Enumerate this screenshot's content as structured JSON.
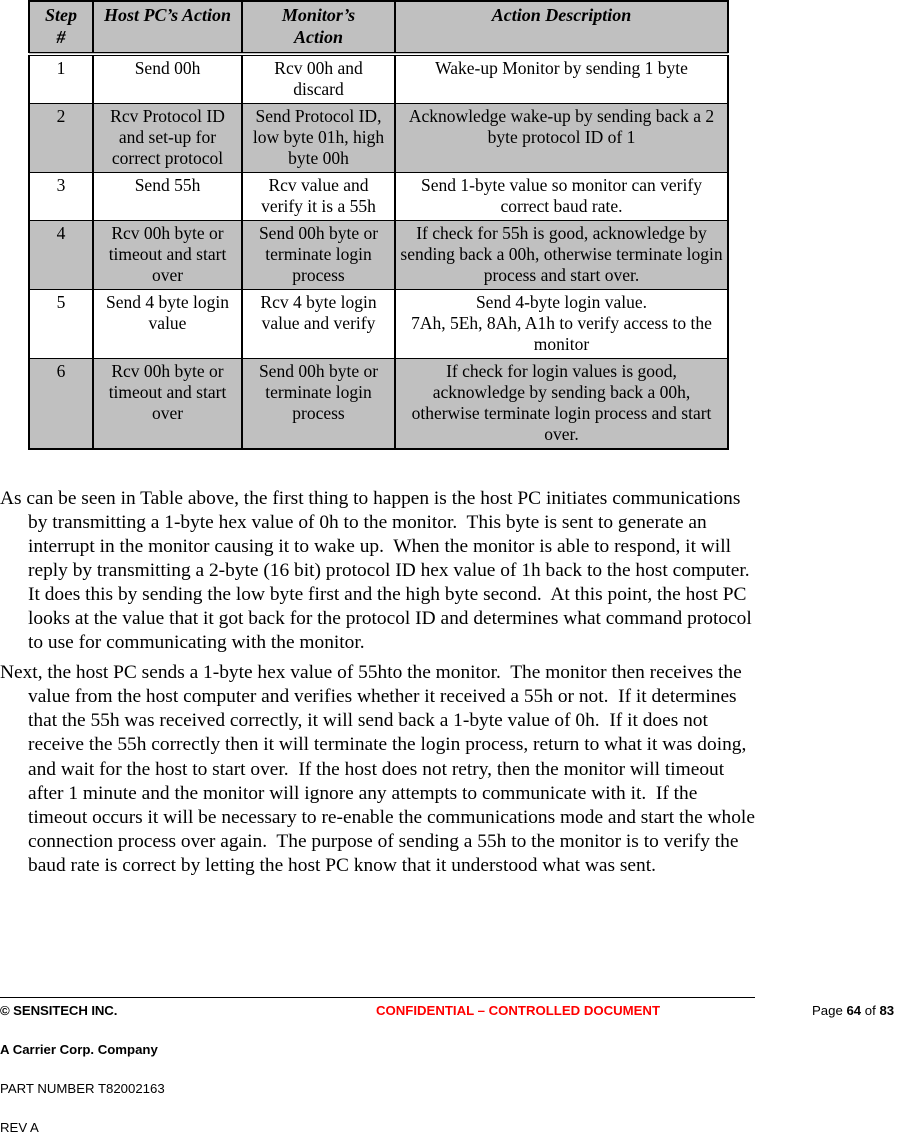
{
  "table": {
    "headers": [
      "Step\n#",
      "Host PC’s Action",
      "Monitor’s\nAction",
      "Action Description"
    ],
    "rows": [
      {
        "shaded": false,
        "step": "1",
        "host_action": "Send 00h",
        "monitor_action": "Rcv 00h and discard",
        "description": "Wake-up Monitor by sending 1 byte"
      },
      {
        "shaded": true,
        "step": "2",
        "host_action": "Rcv Protocol ID and set-up for correct protocol",
        "monitor_action": "Send Protocol ID, low byte 01h, high byte 00h",
        "description": "Acknowledge wake-up by sending back a 2 byte protocol ID of 1"
      },
      {
        "shaded": false,
        "step": "3",
        "host_action": "Send 55h",
        "monitor_action": "Rcv value and verify it is a 55h",
        "description": "Send 1-byte value so monitor can verify correct baud rate."
      },
      {
        "shaded": true,
        "step": "4",
        "host_action": "Rcv 00h byte or timeout and start over",
        "monitor_action": "Send 00h byte or terminate login process",
        "description": "If check for 55h is good, acknowledge by sending back a 00h, otherwise terminate login process and start over."
      },
      {
        "shaded": false,
        "step": "5",
        "host_action": "Send 4 byte login value",
        "monitor_action": "Rcv 4 byte login value and verify",
        "description": "Send 4-byte login value.\n7Ah, 5Eh, 8Ah, A1h to verify access to the monitor"
      },
      {
        "shaded": true,
        "step": "6",
        "host_action": "Rcv 00h byte or timeout and start over",
        "monitor_action": "Send 00h byte or terminate login process",
        "description": "If check for login values is good, acknowledge by sending back a 00h, otherwise terminate login process and start over."
      }
    ]
  },
  "body": {
    "paragraph_1": "As can be seen in Table above, the first thing to happen is the host PC initiates communications by transmitting a 1-byte hex value of 0h to the monitor.  This byte is sent to generate an interrupt in the monitor causing it to wake up.  When the monitor is able to respond, it will reply by transmitting a 2-byte (16 bit) protocol ID hex value of 1h back to the host computer.  It does this by sending the low byte first and the high byte second.  At this point, the host PC looks at the value that it got back for the protocol ID and determines what command protocol to use for communicating with the monitor.",
    "paragraph_2": "Next, the host PC sends a 1-byte hex value of 55hto the monitor.  The monitor then receives the value from the host computer and verifies whether it received a 55h or not.  If it determines that the 55h was received correctly, it will send back a 1-byte value of 0h.  If it does not receive the 55h correctly then it will terminate the login process, return to what it was doing, and wait for the host to start over.  If the host does not retry, then the monitor will timeout after 1 minute and the monitor will ignore any attempts to communicate with it.  If the timeout occurs it will be necessary to re-enable the communications mode and start the whole connection process over again.  The purpose of sending a 55h to the monitor is to verify the baud rate is correct by letting the host PC know that it understood what was sent."
  },
  "footer": {
    "company": "© SENSITECH INC.",
    "confidential": "CONFIDENTIAL – CONTROLLED DOCUMENT",
    "page_prefix": "Page ",
    "page_number": "64",
    "page_middle": " of ",
    "page_total": "83",
    "carrier": "A Carrier Corp. Company",
    "part_number": "PART NUMBER T82002163",
    "revision": "REV A",
    "confidential_color": "#ff0000"
  }
}
